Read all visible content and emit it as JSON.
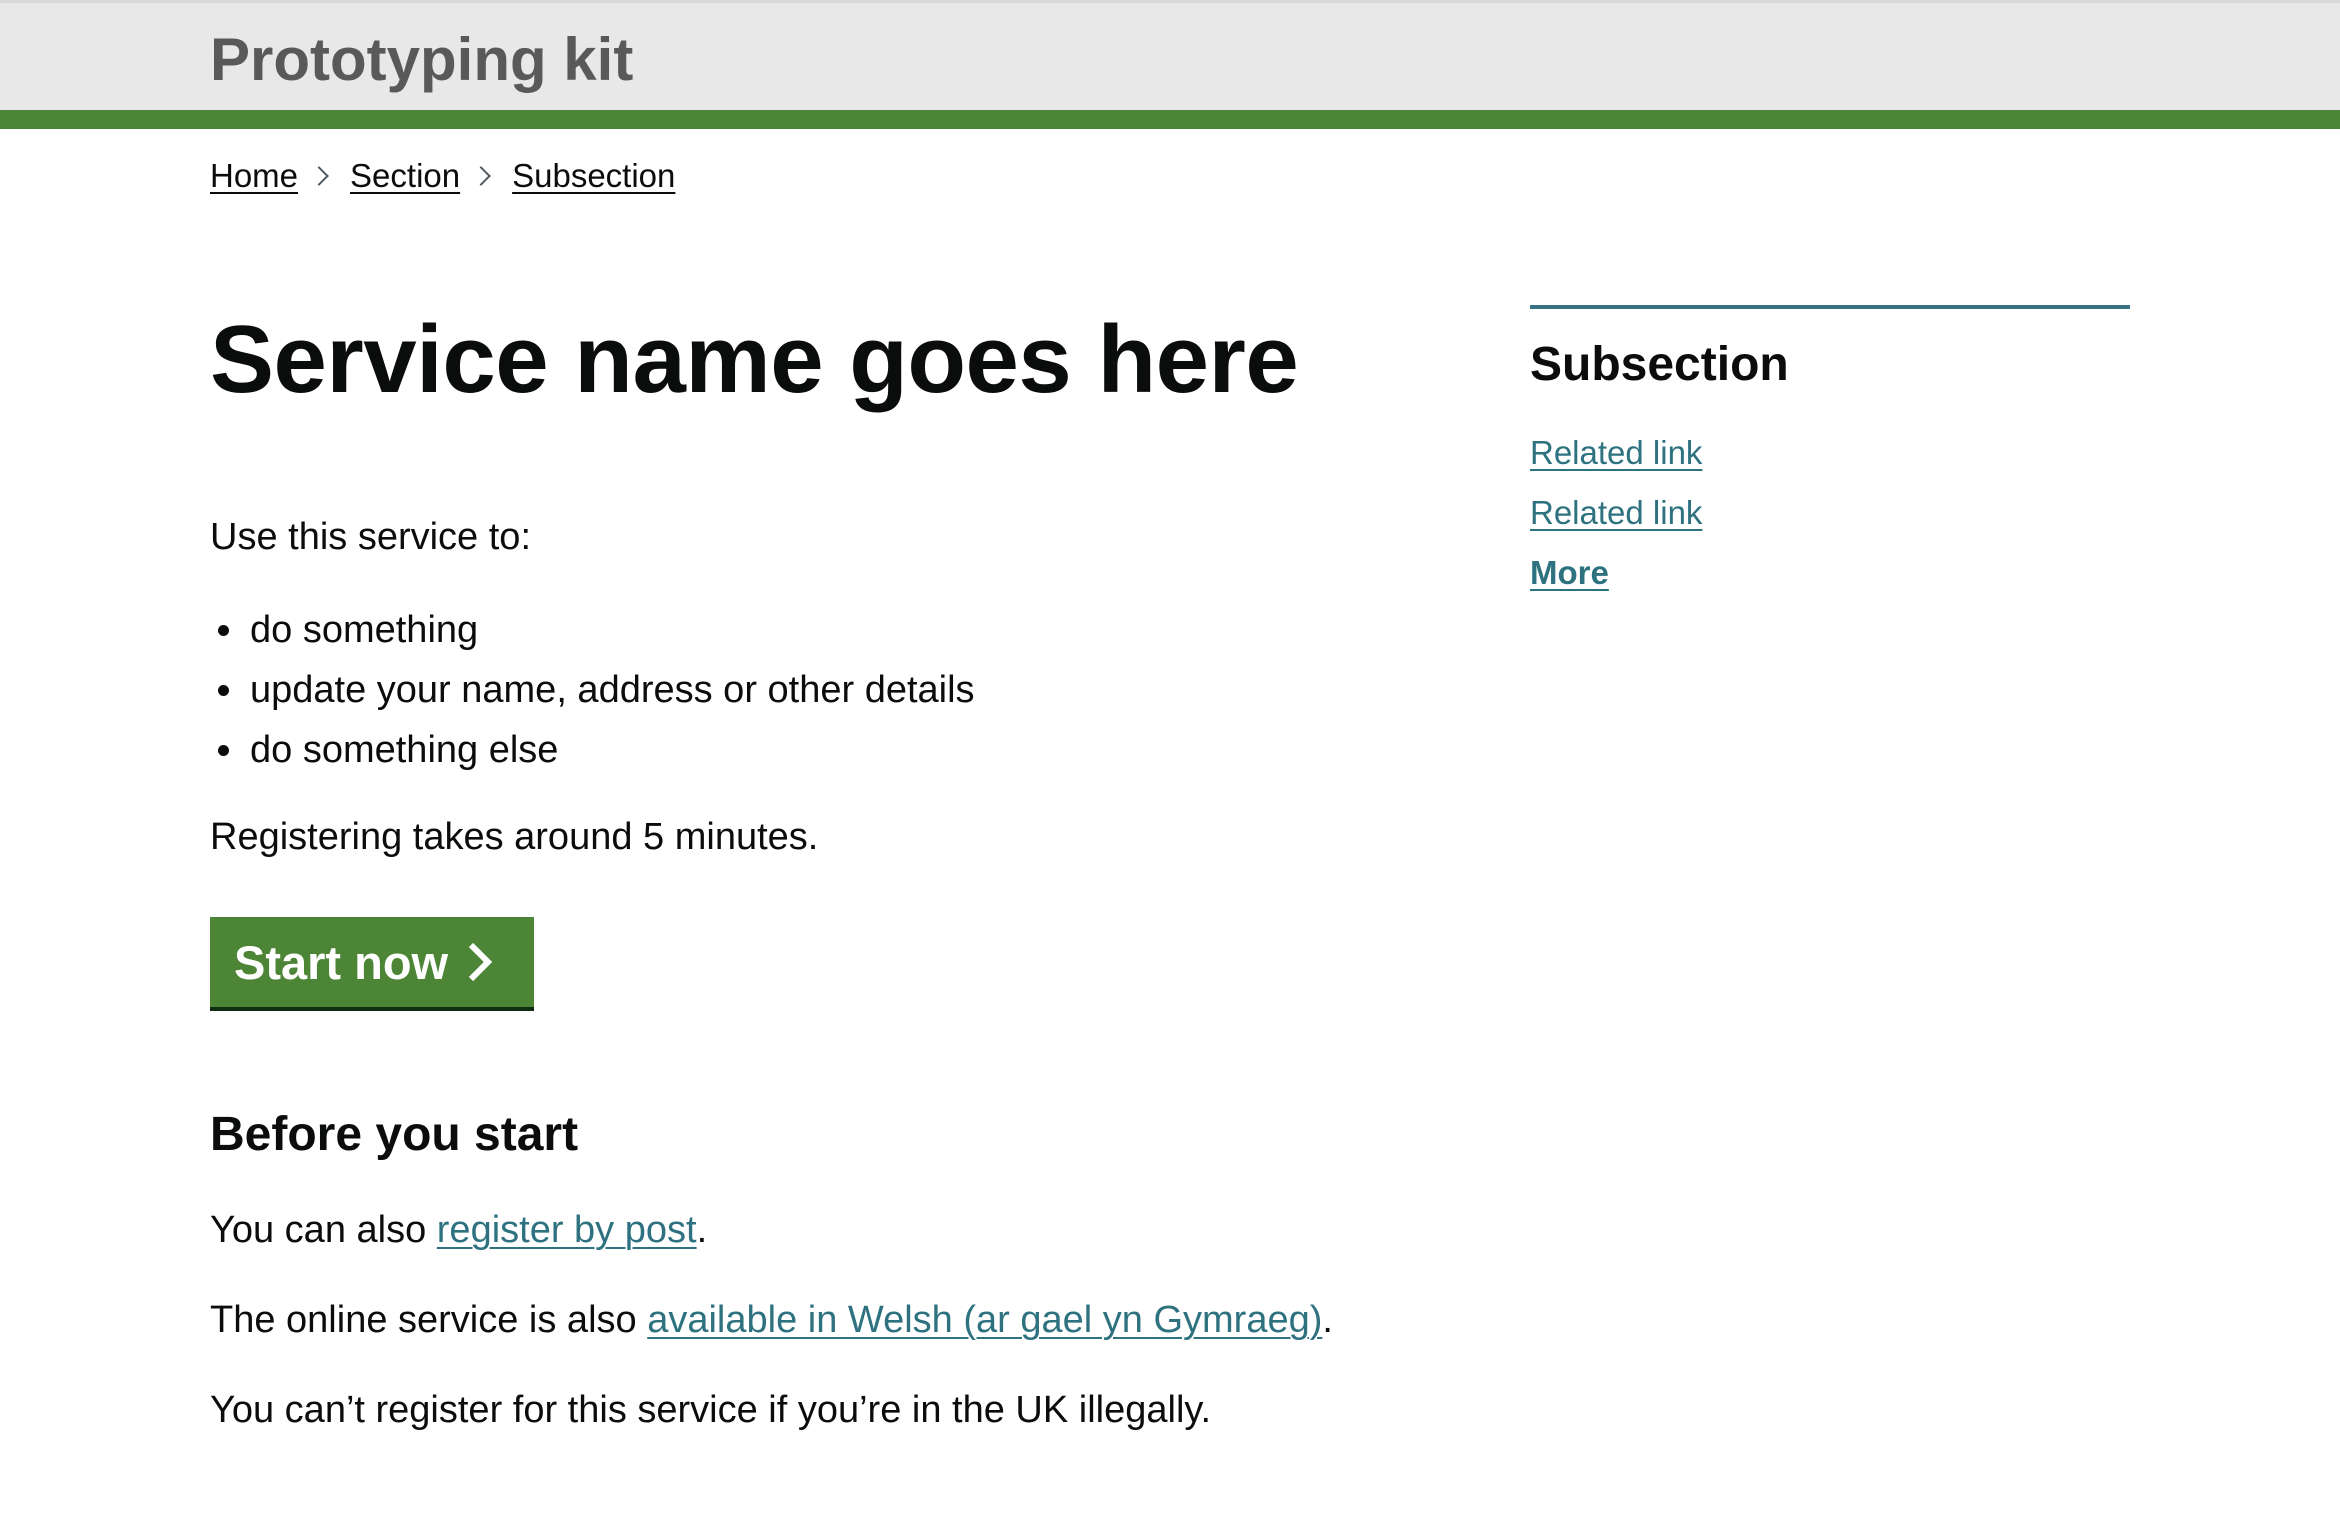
{
  "header": {
    "title": "Prototyping kit",
    "accent_color": "#4d8537"
  },
  "breadcrumbs": [
    "Home",
    "Section",
    "Subsection"
  ],
  "main": {
    "title": "Service name goes here",
    "intro": "Use this service to:",
    "tasks": [
      "do something",
      "update your name, address or other details",
      "do something else"
    ],
    "duration": "Registering takes around 5 minutes.",
    "start_button": "Start now",
    "before_heading": "Before you start",
    "post_prefix": "You can also ",
    "post_link": "register by post",
    "post_suffix": ".",
    "welsh_prefix": "The online service is also ",
    "welsh_link": "available in Welsh (ar gael yn Gymraeg)",
    "welsh_suffix": ".",
    "illegal_note": "You can’t register for this service if you’re in the UK illegally."
  },
  "aside": {
    "title": "Subsection",
    "links": [
      "Related link",
      "Related link",
      "More"
    ],
    "link_color": "#2e7280"
  }
}
